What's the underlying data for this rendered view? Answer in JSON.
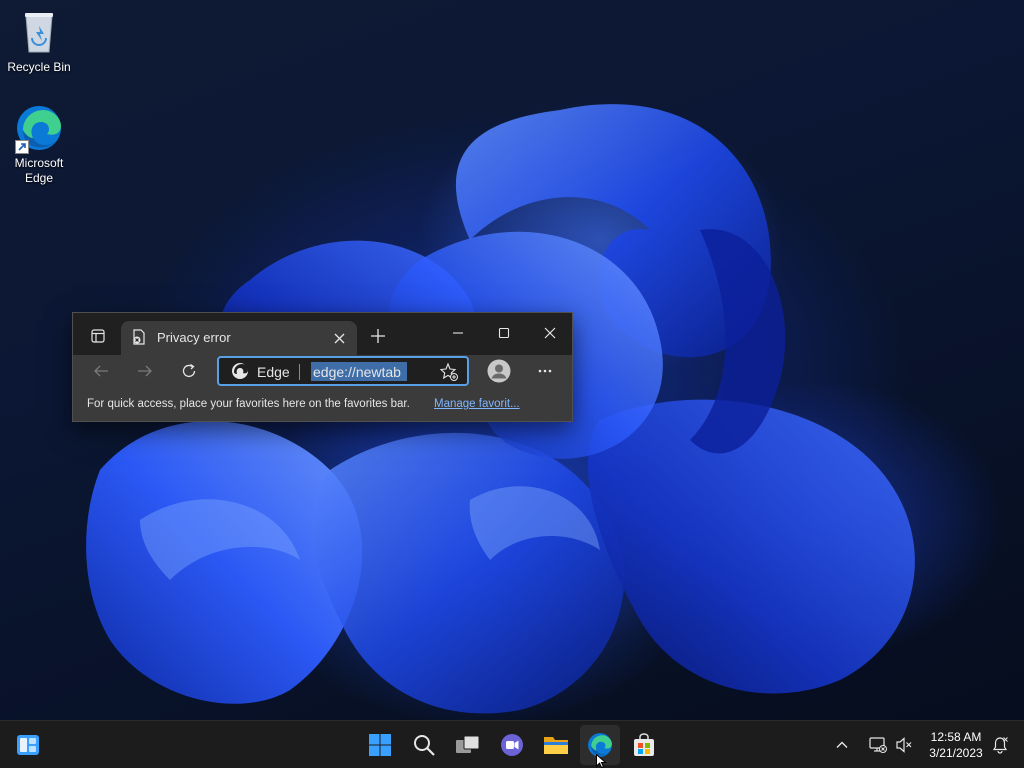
{
  "desktop": {
    "icons": [
      {
        "label": "Recycle Bin"
      },
      {
        "label": "Microsoft\nEdge"
      }
    ]
  },
  "browser": {
    "tab": {
      "title": "Privacy error"
    },
    "address": {
      "site_name": "Edge",
      "url": "edge://newtab"
    },
    "favorites_bar": {
      "message": "For quick access, place your favorites here on the favorites bar.",
      "link": "Manage favorit..."
    }
  },
  "taskbar": {
    "apps": [
      "widgets",
      "start",
      "search",
      "task-view",
      "chat",
      "file-explorer",
      "edge",
      "store"
    ],
    "active_app": "edge"
  },
  "clock": {
    "time": "12:58 AM",
    "date": "3/21/2023"
  },
  "colors": {
    "accent": "#5aa0e6",
    "link": "#7fb6ff",
    "selection": "#3e6da8"
  }
}
